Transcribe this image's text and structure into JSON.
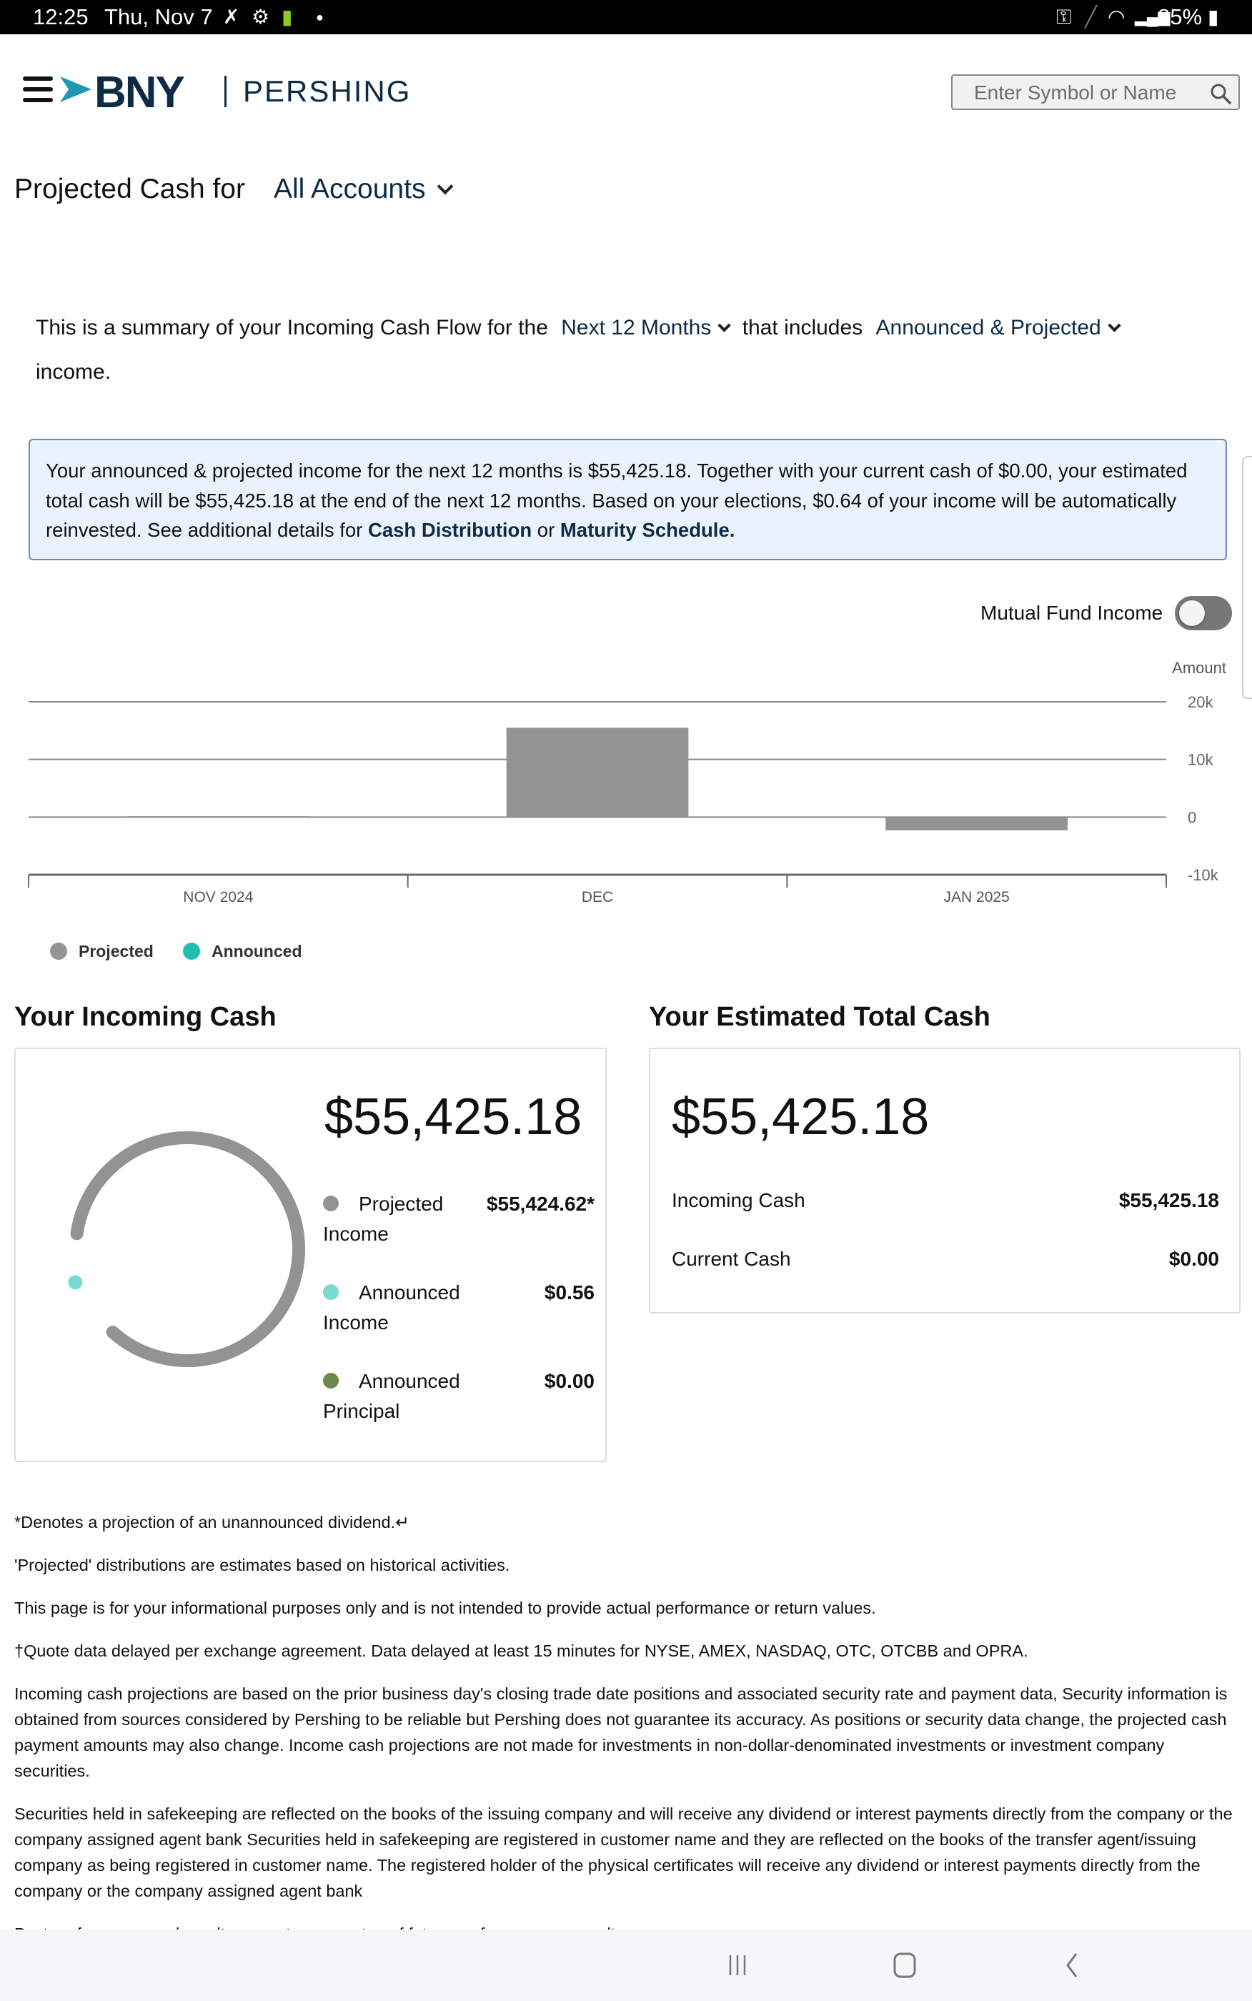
{
  "status_bar": {
    "time": "12:25",
    "date": "Thu, Nov 7",
    "battery": "85%",
    "icons": [
      "tools-icon",
      "gear-icon",
      "android-icon",
      "dot-icon",
      "key-icon",
      "pen-icon",
      "wifi-icon",
      "signal-icon",
      "battery-charging-icon"
    ]
  },
  "header": {
    "brand": "BNY",
    "sub_brand": "PERSHING",
    "search_placeholder": "Enter Symbol or Name"
  },
  "page": {
    "title": "Projected Cash for",
    "account_selector": "All Accounts"
  },
  "summary": {
    "prefix": "This is a summary of your Incoming Cash Flow for the",
    "period_selector": "Next 12 Months",
    "middle": "that includes",
    "type_selector": "Announced & Projected",
    "suffix": "income."
  },
  "info_box": {
    "text": "Your announced & projected income for the next 12 months is $55,425.18. Together with your current cash of $0.00, your estimated total cash will be $55,425.18 at the end of the next 12 months. Based on your elections, $0.64 of your income will be automatically reinvested. See additional details for ",
    "link1": "Cash Distribution",
    "between": " or ",
    "link2": "Maturity Schedule."
  },
  "toggle": {
    "label": "Mutual Fund Income",
    "on": false
  },
  "chart_data": {
    "type": "bar",
    "ylabel": "Amount",
    "categories": [
      "NOV 2024",
      "DEC",
      "JAN 2025"
    ],
    "series": [
      {
        "name": "Projected",
        "color": "#939393",
        "values": [
          150,
          15500,
          -2300
        ]
      },
      {
        "name": "Announced",
        "color": "#1fbfae",
        "values": [
          0,
          0,
          0
        ]
      }
    ],
    "ylim": [
      -10000,
      20000
    ],
    "yticks": [
      20000,
      10000,
      0,
      -10000
    ],
    "ytick_labels": [
      "20k",
      "10k",
      "0",
      "-10k"
    ],
    "grid": true,
    "legend": "bottom-left"
  },
  "legend": [
    {
      "label": "Projected",
      "color": "#939393"
    },
    {
      "label": "Announced",
      "color": "#1fbfae"
    }
  ],
  "incoming_cash": {
    "heading": "Your Incoming Cash",
    "total": "$55,425.18",
    "items": [
      {
        "label": "Projected Income",
        "line1": "Projected",
        "line2": "Income",
        "value": "$55,424.62*",
        "color": "#939393",
        "amount": 55424.62
      },
      {
        "label": "Announced Income",
        "line1": "Announced",
        "line2": "Income",
        "value": "$0.56",
        "color": "#7ad9d2",
        "amount": 0.56
      },
      {
        "label": "Announced Principal",
        "line1": "Announced",
        "line2": "Principal",
        "value": "$0.00",
        "color": "#6a8a4a",
        "amount": 0.0
      }
    ]
  },
  "estimated_total": {
    "heading": "Your Estimated Total Cash",
    "total": "$55,425.18",
    "rows": [
      {
        "label": "Incoming Cash",
        "value": "$55,425.18"
      },
      {
        "label": "Current Cash",
        "value": "$0.00"
      }
    ]
  },
  "footnotes": [
    "*Denotes a projection of an unannounced dividend.↵",
    "'Projected' distributions are estimates based on historical activities.",
    "This page is for your informational purposes only and is not intended to provide actual performance or return values.",
    "†Quote data delayed per exchange agreement. Data delayed at least 15 minutes for NYSE, AMEX, NASDAQ, OTC, OTCBB and OPRA.",
    "Incoming cash projections are based on the prior business day's closing trade date positions and associated security rate and payment data, Security information is obtained from sources considered by Pershing to be reliable but Pershing does not guarantee its accuracy. As positions or security data change, the projected cash payment amounts may also change. Income cash projections are not made for investments in non-dollar-denominated investments or investment company securities.",
    "Securities held in safekeeping are reflected on the books of the issuing company and will receive any dividend or interest payments directly from the company or the company assigned agent bank Securities held in safekeeping are registered in customer name and they are reflected on the books of the transfer agent/issuing company as being registered in customer name. The registered holder of the physical certificates will receive any dividend or interest payments directly from the company or the company assigned agent bank",
    "Past performance and results are not a guarantee of future performance or results."
  ],
  "nav_bar": {
    "buttons": [
      "recent-apps",
      "home",
      "back"
    ]
  }
}
